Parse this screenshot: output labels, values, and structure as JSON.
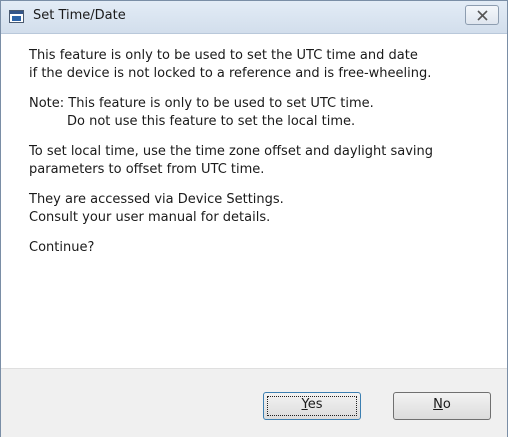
{
  "window": {
    "title": "Set Time/Date",
    "close_symbol": "⊠"
  },
  "message": {
    "p1_line1": "This feature is only to be used to set the UTC time and date",
    "p1_line2": "if the device is not locked to a reference and is free-wheeling.",
    "p2_line1": "Note: This feature is only to be used to set UTC time.",
    "p2_line2": "Do not use this feature to set the local time.",
    "p3_line1": "To set local time, use the time zone offset and daylight saving",
    "p3_line2": "parameters to offset from UTC time.",
    "p4_line1": "They are accessed via Device Settings.",
    "p4_line2": "Consult your user manual for details.",
    "p5_line1": "Continue?"
  },
  "buttons": {
    "yes_accel": "Y",
    "yes_rest": "es",
    "no_accel": "N",
    "no_rest": "o"
  },
  "icons": {
    "window_icon": "application-window-icon",
    "close_icon": "close-x-icon"
  }
}
